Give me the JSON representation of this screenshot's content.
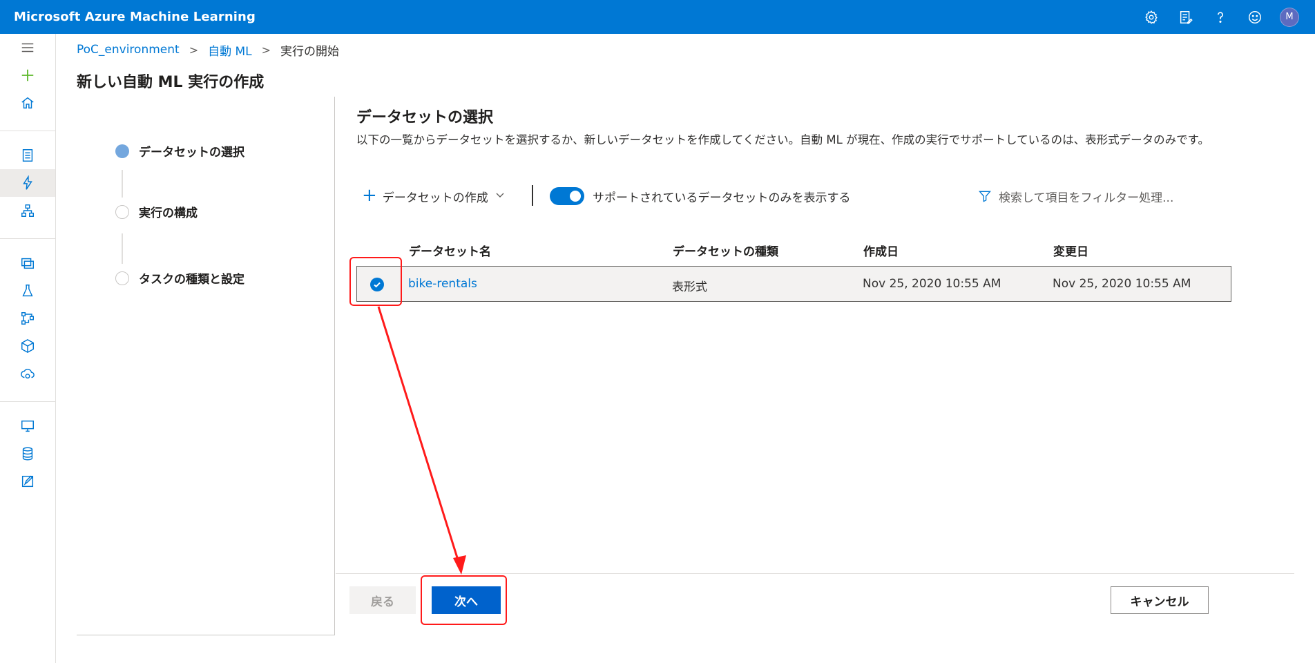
{
  "app": {
    "title": "Microsoft Azure Machine Learning",
    "avatar_initial": "M",
    "top_icons": [
      "settings-icon",
      "feedback-icon",
      "help-icon",
      "smiley-icon"
    ]
  },
  "sidebar": {
    "icons": [
      "hamburger-icon",
      "plus-icon",
      "home-icon",
      "notebook-icon",
      "automl-icon",
      "designer-icon",
      "datasets-icon",
      "experiments-icon",
      "pipelines-icon",
      "models-icon",
      "endpoints-icon",
      "compute-icon",
      "datastores-icon",
      "data-labeling-icon"
    ],
    "accent_color": "#5cb82a"
  },
  "breadcrumb": {
    "items": [
      "PoC_environment",
      "自動 ML",
      "実行の開始"
    ]
  },
  "page_title": "新しい自動 ML 実行の作成",
  "steps": [
    {
      "label": "データセットの選択",
      "active": true
    },
    {
      "label": "実行の構成",
      "active": false
    },
    {
      "label": "タスクの種類と設定",
      "active": false
    }
  ],
  "section": {
    "title": "データセットの選択",
    "description": "以下の一覧からデータセットを選択するか、新しいデータセットを作成してください。自動 ML が現在、作成の実行でサポートしているのは、表形式データのみです。"
  },
  "toolbar": {
    "create_label": "データセットの作成",
    "toggle_label": "サポートされているデータセットのみを表示する",
    "toggle_on": true,
    "filter_placeholder": "検索して項目をフィルター処理..."
  },
  "table": {
    "columns": [
      "データセット名",
      "データセットの種類",
      "作成日",
      "変更日"
    ],
    "rows": [
      {
        "name": "bike-rentals",
        "type": "表形式",
        "created": "Nov 25, 2020 10:55 AM",
        "modified": "Nov 25, 2020 10:55 AM",
        "selected": true
      }
    ]
  },
  "footer": {
    "back_label": "戻る",
    "next_label": "次へ",
    "cancel_label": "キャンセル"
  },
  "colors": {
    "brand": "#0078d4",
    "annotation": "#ff1a1a"
  }
}
